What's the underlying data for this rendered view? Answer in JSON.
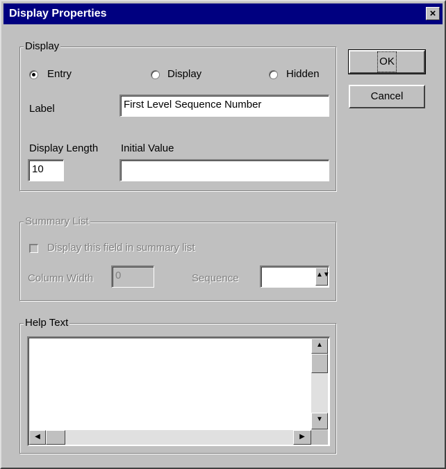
{
  "window": {
    "title": "Display Properties",
    "close_glyph": "×"
  },
  "display_group": {
    "legend": "Display",
    "radios": [
      {
        "label": "Entry",
        "checked": true
      },
      {
        "label": "Display",
        "checked": false
      },
      {
        "label": "Hidden",
        "checked": false
      }
    ],
    "label_caption": "Label",
    "label_value": "First Level Sequence Number",
    "display_length_caption": "Display Length",
    "display_length_value": "10",
    "initial_value_caption": "Initial Value",
    "initial_value_value": ""
  },
  "summary_group": {
    "legend": "Summary List",
    "checkbox_label": "Display this field in summary list",
    "column_width_caption": "Column Width",
    "column_width_value": "0",
    "sequence_caption": "Sequence",
    "sequence_value": ""
  },
  "help_group": {
    "legend": "Help Text",
    "text": ""
  },
  "buttons": {
    "ok": "OK",
    "cancel": "Cancel"
  },
  "icons": {
    "close": "close-icon",
    "spin": "spin-arrows-icon",
    "scroll_up": "arrow-up-icon",
    "scroll_down": "arrow-down-icon",
    "scroll_left": "arrow-left-icon",
    "scroll_right": "arrow-right-icon"
  },
  "colors": {
    "titlebar": "#000080",
    "face": "#c0c0c0",
    "disabled_text": "#808080"
  }
}
